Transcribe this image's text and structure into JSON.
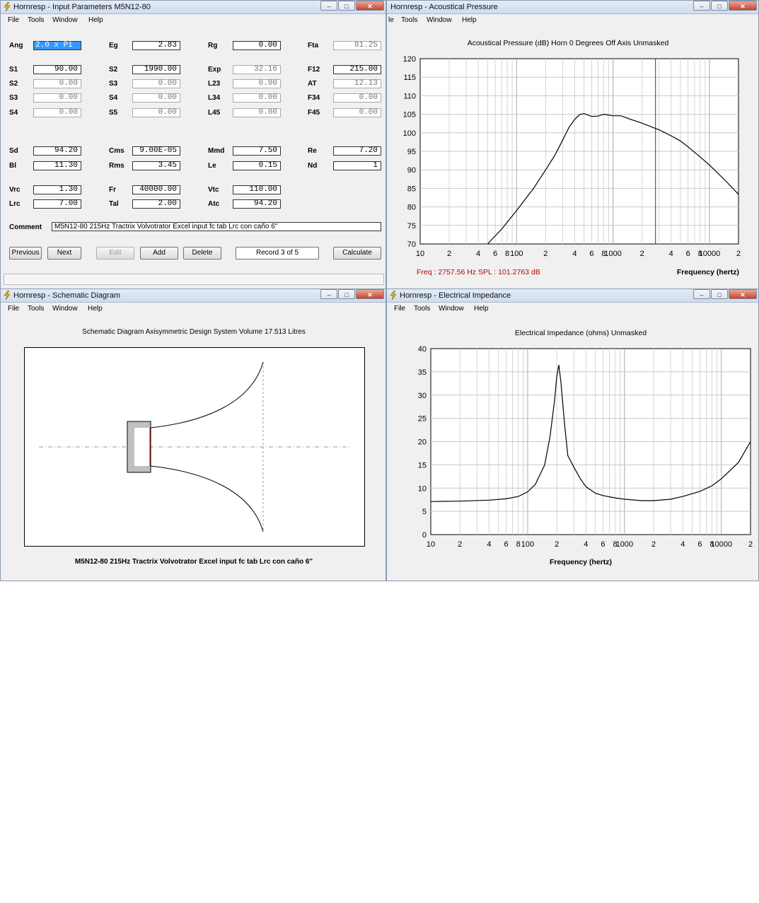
{
  "input_window": {
    "title": "Hornresp - Input Parameters  M5N12-80",
    "menu": [
      "File",
      "Tools",
      "Window",
      "Help"
    ],
    "fields": [
      {
        "label": "Ang",
        "value": "2.0 x Pi",
        "col": 0,
        "row": 0,
        "state": "selected"
      },
      {
        "label": "Eg",
        "value": "2.83",
        "col": 1,
        "row": 0,
        "state": "normal"
      },
      {
        "label": "Rg",
        "value": "0.00",
        "col": 2,
        "row": 0,
        "state": "normal"
      },
      {
        "label": "Fta",
        "value": "81.25",
        "col": 3,
        "row": 0,
        "state": "dim"
      },
      {
        "label": "S1",
        "value": "90.00",
        "col": 0,
        "row": 1,
        "state": "normal"
      },
      {
        "label": "S2",
        "value": "1990.00",
        "col": 1,
        "row": 1,
        "state": "normal"
      },
      {
        "label": "Exp",
        "value": "32.16",
        "col": 2,
        "row": 1,
        "state": "dim"
      },
      {
        "label": "F12",
        "value": "215.00",
        "col": 3,
        "row": 1,
        "state": "normal"
      },
      {
        "label": "S2",
        "value": "0.00",
        "col": 0,
        "row": 2,
        "state": "dim"
      },
      {
        "label": "S3",
        "value": "0.00",
        "col": 1,
        "row": 2,
        "state": "dim"
      },
      {
        "label": "L23",
        "value": "0.00",
        "col": 2,
        "row": 2,
        "state": "dim"
      },
      {
        "label": "AT",
        "value": "12.13",
        "col": 3,
        "row": 2,
        "state": "dim"
      },
      {
        "label": "S3",
        "value": "0.00",
        "col": 0,
        "row": 3,
        "state": "dim"
      },
      {
        "label": "S4",
        "value": "0.00",
        "col": 1,
        "row": 3,
        "state": "dim"
      },
      {
        "label": "L34",
        "value": "0.00",
        "col": 2,
        "row": 3,
        "state": "dim"
      },
      {
        "label": "F34",
        "value": "0.00",
        "col": 3,
        "row": 3,
        "state": "dim"
      },
      {
        "label": "S4",
        "value": "0.00",
        "col": 0,
        "row": 4,
        "state": "dim"
      },
      {
        "label": "S5",
        "value": "0.00",
        "col": 1,
        "row": 4,
        "state": "dim"
      },
      {
        "label": "L45",
        "value": "0.00",
        "col": 2,
        "row": 4,
        "state": "dim"
      },
      {
        "label": "F45",
        "value": "0.00",
        "col": 3,
        "row": 4,
        "state": "dim"
      },
      {
        "label": "Sd",
        "value": "94.20",
        "col": 0,
        "row": 5,
        "state": "normal"
      },
      {
        "label": "Cms",
        "value": "9.00E-05",
        "col": 1,
        "row": 5,
        "state": "normal"
      },
      {
        "label": "Mmd",
        "value": "7.50",
        "col": 2,
        "row": 5,
        "state": "normal"
      },
      {
        "label": "Re",
        "value": "7.20",
        "col": 3,
        "row": 5,
        "state": "normal"
      },
      {
        "label": "Bl",
        "value": "11.30",
        "col": 0,
        "row": 6,
        "state": "normal"
      },
      {
        "label": "Rms",
        "value": "3.45",
        "col": 1,
        "row": 6,
        "state": "normal"
      },
      {
        "label": "Le",
        "value": "0.15",
        "col": 2,
        "row": 6,
        "state": "normal"
      },
      {
        "label": "Nd",
        "value": "1",
        "col": 3,
        "row": 6,
        "state": "normal"
      },
      {
        "label": "Vrc",
        "value": "1.30",
        "col": 0,
        "row": 7,
        "state": "normal"
      },
      {
        "label": "Fr",
        "value": "40000.00",
        "col": 1,
        "row": 7,
        "state": "normal"
      },
      {
        "label": "Vtc",
        "value": "110.00",
        "col": 2,
        "row": 7,
        "state": "normal"
      },
      {
        "label": "Lrc",
        "value": "7.00",
        "col": 0,
        "row": 8,
        "state": "normal"
      },
      {
        "label": "Tal",
        "value": "2.00",
        "col": 1,
        "row": 8,
        "state": "normal"
      },
      {
        "label": "Atc",
        "value": "94.20",
        "col": 2,
        "row": 8,
        "state": "normal"
      }
    ],
    "comment_label": "Comment",
    "comment_value": "M5N12-80   215Hz Tractrix Volvotrator Excel input fc tab   Lrc con caño 6\"",
    "buttons": {
      "previous": "Previous",
      "next": "Next",
      "edit": "Edit",
      "add": "Add",
      "delete": "Delete",
      "record": "Record 3 of 5",
      "calculate": "Calculate"
    }
  },
  "pressure_window": {
    "title": "Hornresp - Acoustical Pressure",
    "menu": [
      "le",
      "Tools",
      "Window",
      "Help"
    ],
    "heading": "Acoustical Pressure (dB)   Horn   0 Degrees Off Axis   Unmasked",
    "x_label": "Frequency (hertz)",
    "readout": "Freq : 2757.56 Hz    SPL : 101.2763 dB"
  },
  "schematic_window": {
    "title": "Hornresp - Schematic Diagram",
    "menu": [
      "File",
      "Tools",
      "Window",
      "Help"
    ],
    "heading": "Schematic Diagram   Axisymmetric Design   System Volume 17.513 Litres",
    "caption": "M5N12-80   215Hz Tractrix Volvotrator Excel input fc tab   Lrc con caño 6\""
  },
  "impedance_window": {
    "title": "Hornresp - Electrical Impedance",
    "menu": [
      "File",
      "Tools",
      "Window",
      "Help"
    ],
    "heading": "Electrical Impedance (ohms)   Unmasked",
    "x_label": "Frequency (hertz)"
  },
  "window_buttons": {
    "minimize": "–",
    "maximize": "□",
    "close": "✕"
  },
  "chart_data": [
    {
      "type": "line",
      "title": "Acoustical Pressure (dB)   Horn   0 Degrees Off Axis   Unmasked",
      "xlabel": "Frequency (hertz)",
      "ylabel": "",
      "xscale": "log",
      "xlim": [
        10,
        20000
      ],
      "ylim": [
        70,
        120
      ],
      "yticks": [
        70,
        75,
        80,
        85,
        90,
        95,
        100,
        105,
        110,
        115,
        120
      ],
      "xtick_labels": [
        "10",
        "2",
        "4",
        "6",
        "8",
        "100",
        "2",
        "4",
        "6",
        "8",
        "1000",
        "2",
        "4",
        "6",
        "8",
        "10000",
        "2"
      ],
      "xtick_values": [
        10,
        20,
        40,
        60,
        80,
        100,
        200,
        400,
        600,
        800,
        1000,
        2000,
        4000,
        6000,
        8000,
        10000,
        20000
      ],
      "grid": true,
      "marker_x": 2757.56,
      "marker_color": "#c00000",
      "x": [
        50,
        70,
        100,
        150,
        200,
        250,
        300,
        350,
        400,
        450,
        500,
        600,
        700,
        800,
        1000,
        1200,
        1500,
        2000,
        2500,
        3000,
        4000,
        5000,
        6000,
        8000,
        10000,
        12000,
        15000,
        20000
      ],
      "y": [
        70,
        74,
        79,
        85,
        90,
        94,
        98,
        101.5,
        103.6,
        104.9,
        105.2,
        104.4,
        104.5,
        105,
        104.6,
        104.6,
        103.7,
        102.6,
        101.6,
        100.8,
        99.2,
        97.8,
        96.2,
        93.5,
        91.3,
        89.3,
        86.8,
        83.4
      ]
    },
    {
      "type": "line",
      "title": "Electrical Impedance (ohms)   Unmasked",
      "xlabel": "Frequency (hertz)",
      "ylabel": "",
      "xscale": "log",
      "xlim": [
        10,
        20000
      ],
      "ylim": [
        0,
        40
      ],
      "yticks": [
        0,
        5,
        10,
        15,
        20,
        25,
        30,
        35,
        40
      ],
      "xtick_labels": [
        "10",
        "2",
        "4",
        "6",
        "8",
        "100",
        "2",
        "4",
        "6",
        "8",
        "1000",
        "2",
        "4",
        "6",
        "8",
        "10000",
        "2"
      ],
      "xtick_values": [
        10,
        20,
        40,
        60,
        80,
        100,
        200,
        400,
        600,
        800,
        1000,
        2000,
        4000,
        6000,
        8000,
        10000,
        20000
      ],
      "grid": true,
      "x": [
        10,
        20,
        40,
        60,
        80,
        100,
        120,
        150,
        170,
        190,
        200,
        210,
        220,
        240,
        260,
        300,
        350,
        400,
        500,
        600,
        800,
        1000,
        1500,
        2000,
        3000,
        4000,
        6000,
        8000,
        10000,
        15000,
        20000
      ],
      "y": [
        7.1,
        7.2,
        7.4,
        7.7,
        8.2,
        9.2,
        10.8,
        15,
        21,
        29,
        34,
        36.5,
        33,
        24,
        17,
        14.5,
        12,
        10.3,
        8.9,
        8.4,
        7.9,
        7.6,
        7.3,
        7.3,
        7.6,
        8.2,
        9.3,
        10.5,
        12,
        15.5,
        20
      ]
    }
  ]
}
